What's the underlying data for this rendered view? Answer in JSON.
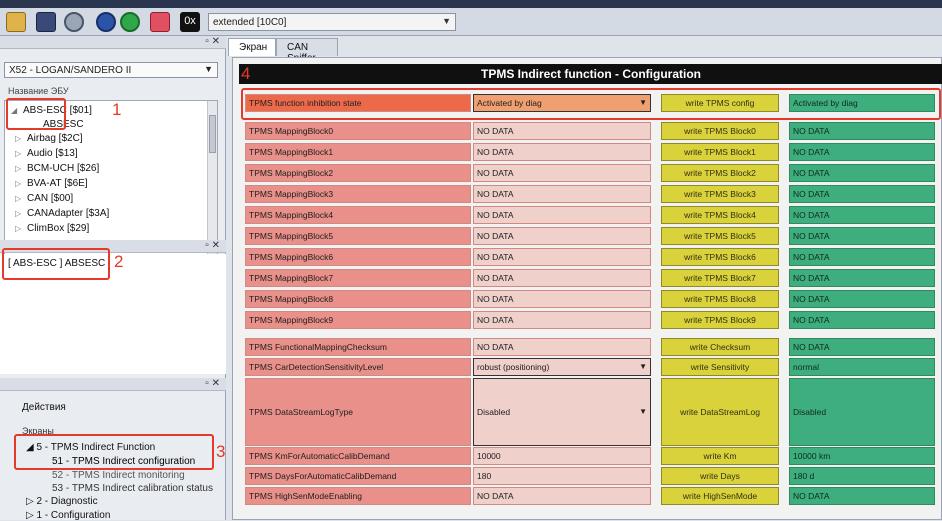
{
  "app": {
    "mode_select": "extended [10C0]",
    "mode_hex_label": "0x"
  },
  "toolbar": {
    "icons": [
      "folder-icon",
      "save-icon",
      "settings-gear-icon",
      "stop-icon",
      "refresh-icon",
      "heart-monitor-icon",
      "hex-mode-icon"
    ]
  },
  "left": {
    "vehicle_combo": "X52 - LOGAN/SANDERO II",
    "ecu_list_header": "Название ЭБУ",
    "ecu_items": [
      "ABS-ESC [$01]",
      "ABSESC",
      "Airbag [$2C]",
      "Audio [$13]",
      "BCM-UCH [$26]",
      "BVA-AT [$6E]",
      "CAN [$00]",
      "CANAdapter [$3A]",
      "ClimBox [$29]"
    ],
    "selected_ecu": "[ ABS-ESC ] ABSESC",
    "actions_label": "Действия",
    "screens_label": "Экраны",
    "screens": [
      "5 - TPMS Indirect Function",
      "51 - TPMS Indirect configuration",
      "52 - TPMS Indirect monitoring",
      "53 - TPMS Indirect calibration status",
      "2 - Diagnostic",
      "1 - Configuration"
    ],
    "markers": [
      "1",
      "2",
      "3"
    ]
  },
  "tabs": [
    "Экран",
    "CAN Sniffer"
  ],
  "screen": {
    "title": "TPMS Indirect function - Configuration",
    "marker": "4",
    "inhibition": {
      "label": "TPMS function inhibition state",
      "value": "Activated by diag",
      "button": "write TPMS config",
      "result": "Activated by diag"
    },
    "mapping": [
      {
        "label": "TPMS MappingBlock0",
        "value": "NO DATA",
        "button": "write TPMS Block0",
        "result": "NO DATA"
      },
      {
        "label": "TPMS MappingBlock1",
        "value": "NO DATA",
        "button": "write TPMS Block1",
        "result": "NO DATA"
      },
      {
        "label": "TPMS MappingBlock2",
        "value": "NO DATA",
        "button": "write TPMS Block2",
        "result": "NO DATA"
      },
      {
        "label": "TPMS MappingBlock3",
        "value": "NO DATA",
        "button": "write TPMS Block3",
        "result": "NO DATA"
      },
      {
        "label": "TPMS MappingBlock4",
        "value": "NO DATA",
        "button": "write TPMS Block4",
        "result": "NO DATA"
      },
      {
        "label": "TPMS MappingBlock5",
        "value": "NO DATA",
        "button": "write TPMS Block5",
        "result": "NO DATA"
      },
      {
        "label": "TPMS MappingBlock6",
        "value": "NO DATA",
        "button": "write TPMS Block6",
        "result": "NO DATA"
      },
      {
        "label": "TPMS MappingBlock7",
        "value": "NO DATA",
        "button": "write TPMS Block7",
        "result": "NO DATA"
      },
      {
        "label": "TPMS MappingBlock8",
        "value": "NO DATA",
        "button": "write TPMS Block8",
        "result": "NO DATA"
      },
      {
        "label": "TPMS MappingBlock9",
        "value": "NO DATA",
        "button": "write TPMS Block9",
        "result": "NO DATA"
      }
    ],
    "checksum": {
      "label": "TPMS FunctionalMappingChecksum",
      "value": "NO DATA",
      "button": "write Checksum",
      "result": "NO DATA"
    },
    "sensitivity": {
      "label": "TPMS CarDetectionSensitivityLevel",
      "value": "robust (positioning)",
      "button": "write Sensitivity",
      "result": "normal"
    },
    "datastream": {
      "label": "TPMS DataStreamLogType",
      "value": "Disabled",
      "button": "write DataStreamLog",
      "result": "Disabled"
    },
    "km": {
      "label": "TPMS KmForAutomaticCalibDemand",
      "value": "10000",
      "button": "write Km",
      "result": "10000 km"
    },
    "days": {
      "label": "TPMS DaysForAutomaticCalibDemand",
      "value": "180",
      "button": "write Days",
      "result": "180 d"
    },
    "highsen": {
      "label": "TPMS HighSenModeEnabling",
      "value": "NO DATA",
      "button": "write HighSenMode",
      "result": "NO DATA"
    }
  }
}
